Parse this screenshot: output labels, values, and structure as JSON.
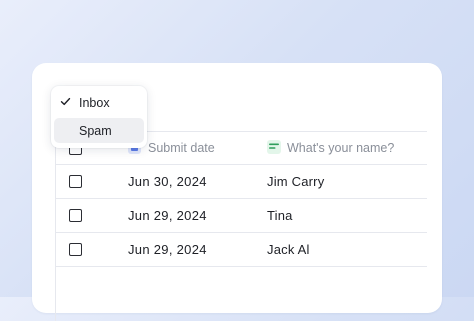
{
  "table": {
    "columns": {
      "date": "Submit date",
      "name": "What's your name?"
    },
    "rows": [
      {
        "date": "Jun 30, 2024",
        "name": "Jim Carry"
      },
      {
        "date": "Jun 29, 2024",
        "name": "Tina"
      },
      {
        "date": "Jun 29, 2024",
        "name": "Jack Al"
      }
    ]
  },
  "dropdown": {
    "options": [
      {
        "label": "Inbox",
        "checked": true
      },
      {
        "label": "Spam",
        "highlighted": true
      }
    ]
  },
  "icons": {
    "check": "check-icon",
    "date_column": "calendar-icon",
    "name_column": "short-text-icon"
  },
  "colors": {
    "date_icon_accent": "#5b7be6",
    "name_icon_accent": "#2e9e5b",
    "hover_bg": "#eeeff2"
  }
}
